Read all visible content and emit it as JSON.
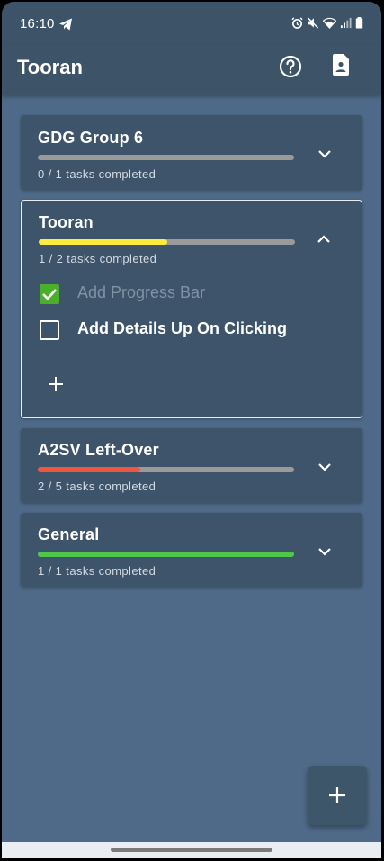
{
  "status_bar": {
    "time": "16:10",
    "icons": [
      "telegram-icon",
      "alarm-icon",
      "mute-icon",
      "wifi-icon",
      "signal-icon",
      "battery-icon"
    ]
  },
  "app_bar": {
    "title": "Tooran",
    "actions": [
      "help-icon",
      "document-icon"
    ]
  },
  "groups": [
    {
      "title": "GDG Group 6",
      "progress": 0.0,
      "bar_color": "#ffeb3b",
      "summary": "0 / 1 tasks completed",
      "expanded": false
    },
    {
      "title": "Tooran",
      "progress": 0.5,
      "bar_color": "#ffeb3b",
      "summary": "1 / 2 tasks completed",
      "expanded": true,
      "tasks": [
        {
          "label": "Add Progress Bar",
          "checked": true
        },
        {
          "label": "Add Details Up On Clicking",
          "checked": false
        }
      ]
    },
    {
      "title": "A2SV Left-Over",
      "progress": 0.4,
      "bar_color": "#f0563f",
      "summary": "2 / 5 tasks completed",
      "expanded": false
    },
    {
      "title": "General",
      "progress": 1.0,
      "bar_color": "#4ec74a",
      "summary": "1 / 1 tasks completed",
      "expanded": false
    }
  ],
  "colors": {
    "background": "#4e6a88",
    "app_bar": "#3d5468",
    "card": "#3e546a",
    "checkbox_checked": "#4caf2a"
  },
  "fab": {
    "icon": "plus-icon"
  }
}
